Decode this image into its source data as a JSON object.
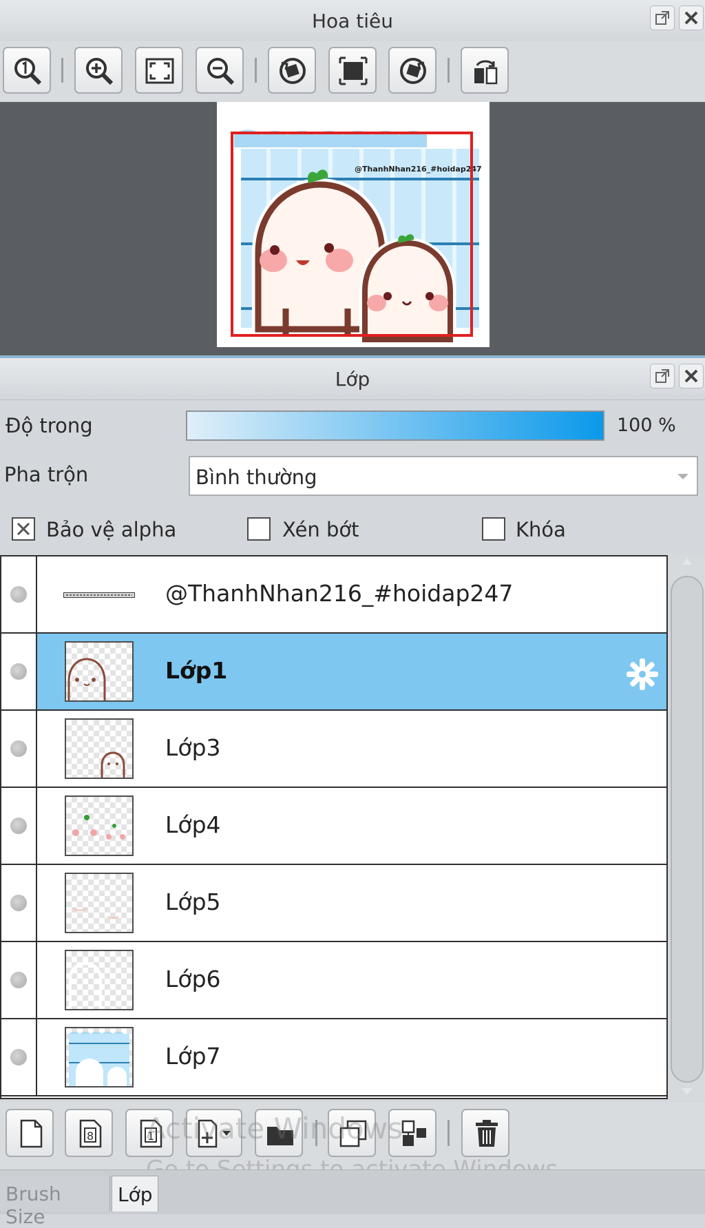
{
  "navigator": {
    "title": "Hoa tiêu",
    "toolbar": [
      {
        "name": "zoom-actual-button",
        "icon": "zoom-actual-icon"
      },
      {
        "name": "zoom-in-button",
        "icon": "zoom-in-icon"
      },
      {
        "name": "fit-window-button",
        "icon": "fit-window-icon"
      },
      {
        "name": "zoom-out-button",
        "icon": "zoom-out-icon"
      },
      {
        "name": "rotate-left-button",
        "icon": "rotate-left-icon"
      },
      {
        "name": "reset-rotation-button",
        "icon": "reset-rotation-icon"
      },
      {
        "name": "rotate-right-button",
        "icon": "rotate-right-icon"
      },
      {
        "name": "flip-horizontal-button",
        "icon": "flip-horizontal-icon"
      }
    ],
    "preview_watermark": "@ThanhNhan216_#hoidap247"
  },
  "layers_panel": {
    "title": "Lớp",
    "opacity_label": "Độ trong",
    "opacity_value": "100 %",
    "opacity_fraction": 1.0,
    "blend_label": "Pha trộn",
    "blend_value": "Bình thường",
    "protect_alpha_label": "Bảo vệ alpha",
    "protect_alpha_checked": true,
    "clipping_label": "Xén bớt",
    "clipping_checked": false,
    "lock_label": "Khóa",
    "lock_checked": false,
    "layers": [
      {
        "name": "@ThanhNhan216_#hoidap247",
        "selected": false
      },
      {
        "name": "Lớp1",
        "selected": true
      },
      {
        "name": "Lớp3",
        "selected": false
      },
      {
        "name": "Lớp4",
        "selected": false
      },
      {
        "name": "Lớp5",
        "selected": false
      },
      {
        "name": "Lớp6",
        "selected": false
      },
      {
        "name": "Lớp7",
        "selected": false
      }
    ],
    "selected_color": "#7ec7f0"
  },
  "watermark": {
    "line1": "Activate Windows",
    "line2": "Go to Settings to activate Windows."
  },
  "tabs": [
    {
      "label": "Brush Size",
      "active": false
    },
    {
      "label": "Lớp",
      "active": true
    }
  ]
}
